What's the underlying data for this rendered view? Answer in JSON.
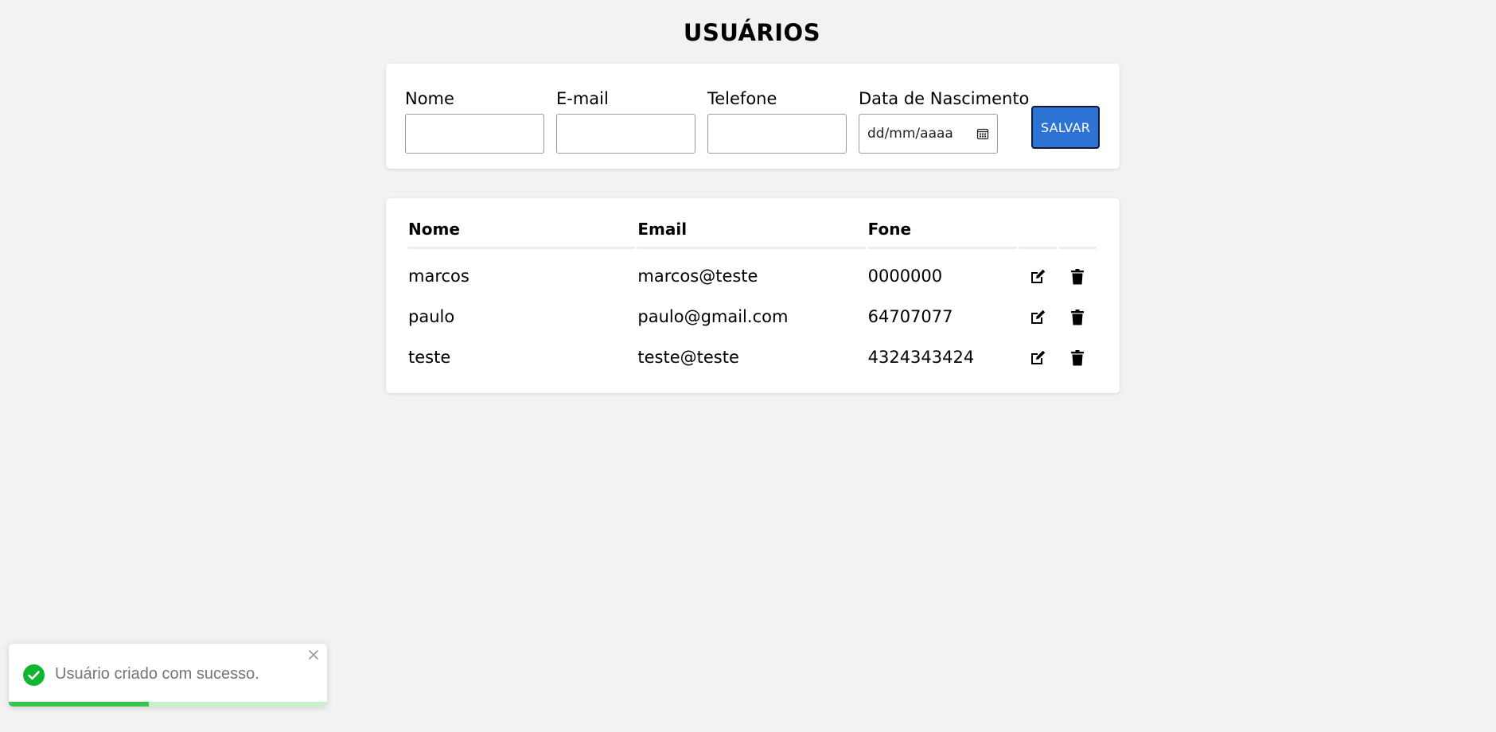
{
  "page": {
    "title": "USUÁRIOS"
  },
  "form": {
    "fields": [
      {
        "label": "Nome",
        "value": ""
      },
      {
        "label": "E-mail",
        "value": ""
      },
      {
        "label": "Telefone",
        "value": ""
      },
      {
        "label": "Data de Nascimento",
        "placeholder": "dd/mm/aaaa"
      }
    ],
    "save_label": "SALVAR"
  },
  "table": {
    "headers": [
      "Nome",
      "Email",
      "Fone"
    ],
    "rows": [
      {
        "nome": "marcos",
        "email": "marcos@teste",
        "fone": "0000000"
      },
      {
        "nome": "paulo",
        "email": "paulo@gmail.com",
        "fone": "64707077"
      },
      {
        "nome": "teste",
        "email": "teste@teste",
        "fone": "4324343424"
      }
    ],
    "row_actions": [
      "edit-icon",
      "trash-icon"
    ]
  },
  "toast": {
    "message": "Usuário criado com sucesso.",
    "icon": "check-circle-icon",
    "progress": 0.44
  },
  "colors": {
    "background": "#f2f2f2",
    "accent": "#2d73d6",
    "success": "#3cc453"
  }
}
